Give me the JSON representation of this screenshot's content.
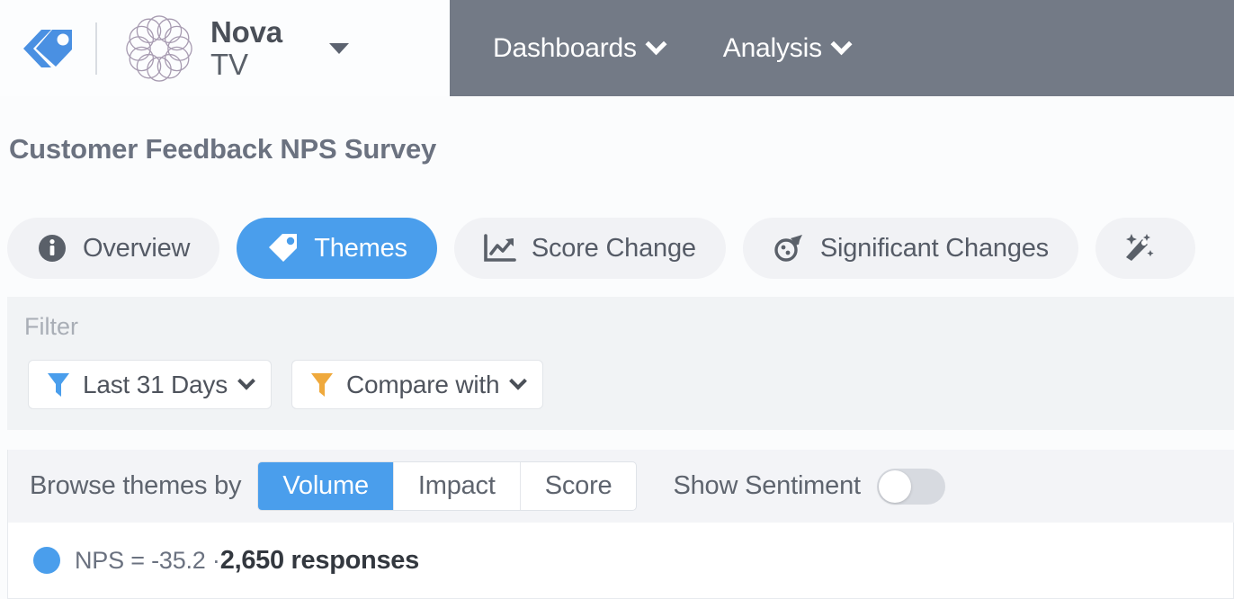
{
  "topbar": {
    "brand_icon": "double-tag-icon",
    "account": {
      "logo_icon": "spirograph-logo",
      "name_line1": "Nova",
      "name_line2": "TV",
      "dropdown_icon": "caret-down-icon"
    },
    "nav": [
      {
        "label": "Dashboards",
        "icon": "chevron-down-icon"
      },
      {
        "label": "Analysis",
        "icon": "chevron-down-icon"
      }
    ],
    "nav_bg": "#737a86"
  },
  "page": {
    "title": "Customer Feedback NPS Survey"
  },
  "tabs": [
    {
      "label": "Overview",
      "icon": "info-circle-icon",
      "active": false
    },
    {
      "label": "Themes",
      "icon": "tag-icon",
      "active": true
    },
    {
      "label": "Score Change",
      "icon": "line-chart-up-icon",
      "active": false
    },
    {
      "label": "Significant Changes",
      "icon": "comet-icon",
      "active": false
    },
    {
      "label": "",
      "icon": "magic-wand-icon",
      "active": false
    }
  ],
  "filter": {
    "label": "Filter",
    "buttons": [
      {
        "label": "Last 31 Days",
        "icon": "funnel-icon",
        "icon_color": "#4a9eec",
        "caret": "chevron-down-icon"
      },
      {
        "label": "Compare with",
        "icon": "funnel-icon",
        "icon_color": "#efa93c",
        "caret": "chevron-down-icon"
      }
    ]
  },
  "browse": {
    "label": "Browse themes by",
    "segments": [
      {
        "label": "Volume",
        "active": true
      },
      {
        "label": "Impact",
        "active": false
      },
      {
        "label": "Score",
        "active": false
      }
    ],
    "sentiment_label": "Show Sentiment",
    "sentiment_on": false
  },
  "summary": {
    "dot_color": "#4a9eec",
    "nps_text": "NPS = -35.2 · ",
    "responses": "2,650 responses"
  },
  "colors": {
    "accent_blue": "#4a9eec",
    "nav_gray": "#737a86",
    "panel_gray": "#f1f3f5"
  }
}
